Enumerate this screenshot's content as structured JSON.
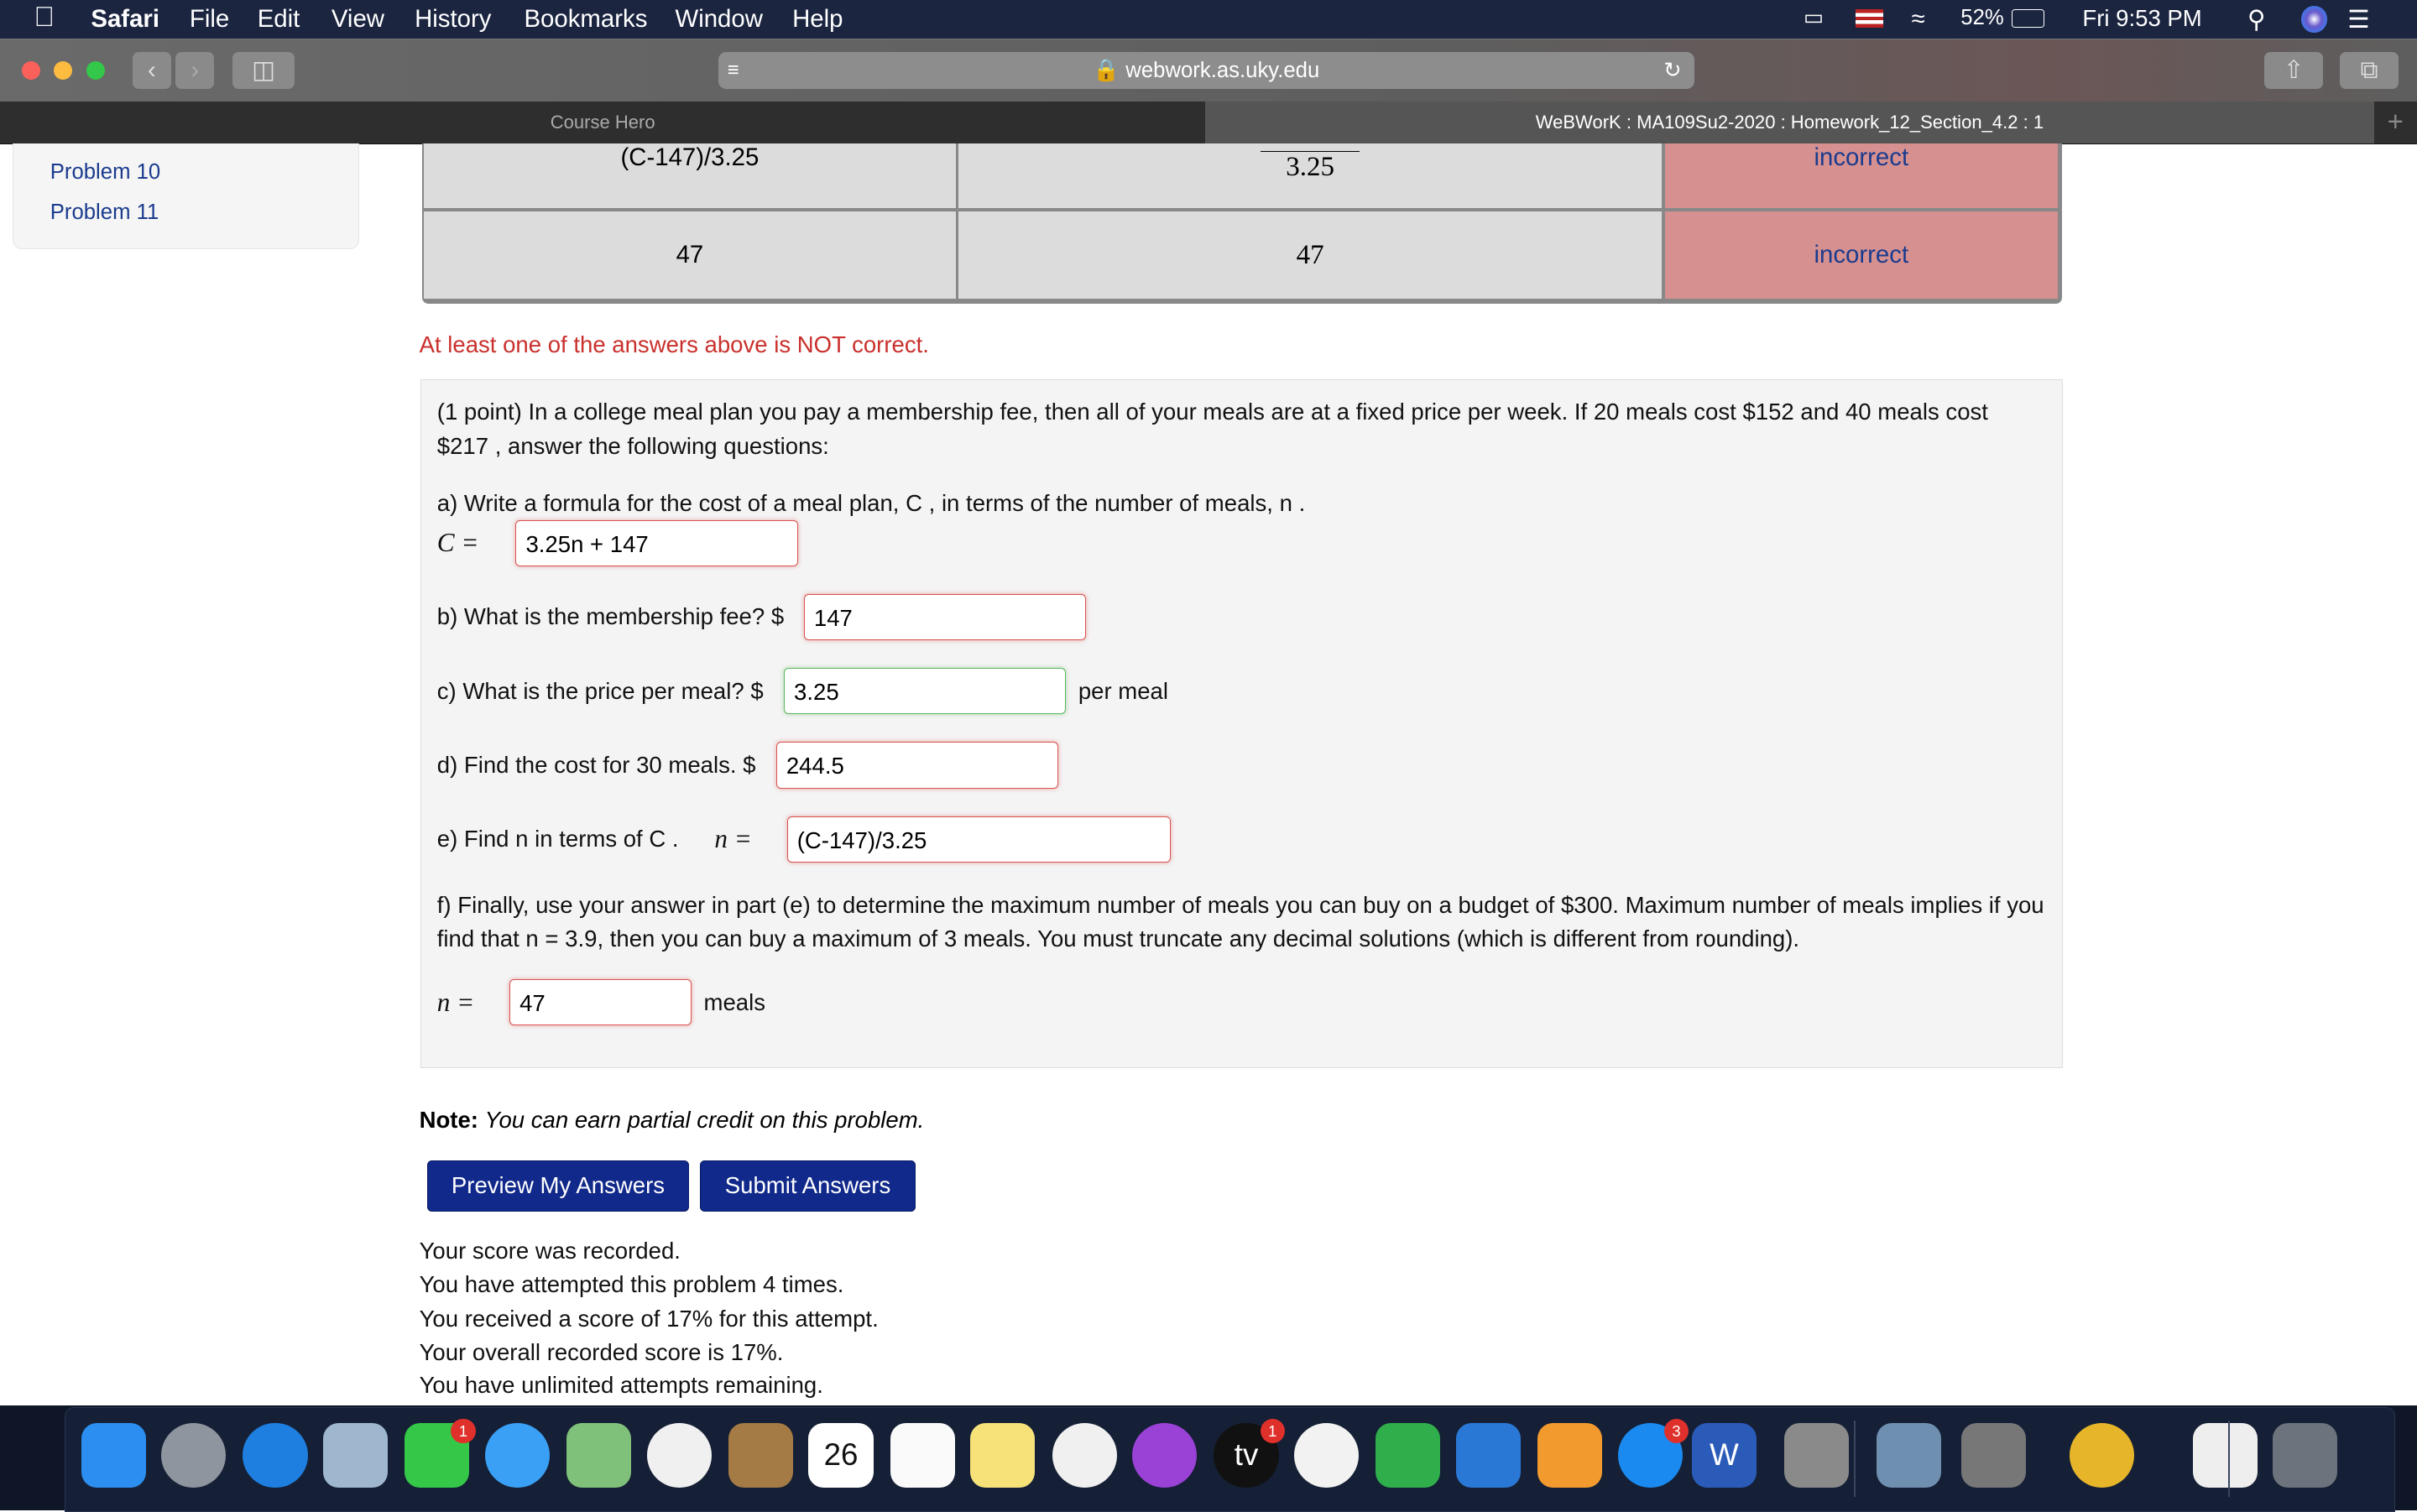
{
  "menubar": {
    "app": "Safari",
    "items": [
      "File",
      "Edit",
      "View",
      "History",
      "Bookmarks",
      "Window",
      "Help"
    ],
    "battery": "52%",
    "clock": "Fri 9:53 PM"
  },
  "toolbar": {
    "url": "webwork.as.uky.edu"
  },
  "tabs": [
    {
      "label": "Course Hero",
      "active": false
    },
    {
      "label": "WeBWorK : MA109Su2-2020 : Homework_12_Section_4.2 : 1",
      "active": true
    }
  ],
  "sidebar": {
    "items": [
      "Problem 10",
      "Problem 11"
    ]
  },
  "results": {
    "rows": [
      {
        "entered": "(C-147)/3.25",
        "preview": "3.25",
        "result": "incorrect"
      },
      {
        "entered": "47",
        "preview": "47",
        "result": "incorrect"
      }
    ]
  },
  "message": "At least one of the answers above is NOT correct.",
  "problem": {
    "intro": "(1 point) In a college meal plan you pay a membership fee, then all of your meals are at a fixed price per week. If 20 meals cost $152 and 40 meals cost $217 , answer the following questions:",
    "a": "a) Write a formula for the cost of a meal plan, C , in terms of the number of meals, n .",
    "a_label": "C =",
    "a_value": "3.25n + 147",
    "b": "b) What is the membership fee? $",
    "b_value": "147",
    "c": "c) What is the price per meal? $",
    "c_value": "3.25",
    "c_suffix": "per meal",
    "d": "d) Find the cost for 30 meals. $",
    "d_value": "244.5",
    "e": "e) Find n in terms of C .",
    "e_label": "n =",
    "e_value": "(C-147)/3.25",
    "f": "f) Finally, use your answer in part (e) to determine the maximum number of meals you can buy on a budget of $300. Maximum number of meals implies if you find that n = 3.9, then you can buy a maximum of 3 meals. You must truncate any decimal solutions (which is different from rounding).",
    "f_label": "n =",
    "f_value": "47",
    "f_suffix": "meals"
  },
  "note": {
    "bold": "Note:",
    "text": "You can earn partial credit on this problem."
  },
  "buttons": {
    "preview": "Preview My Answers",
    "submit": "Submit Answers"
  },
  "score_lines": [
    "Your score was recorded.",
    "You have attempted this problem 4 times.",
    "You received a score of 17% for this attempt.",
    "Your overall recorded score is 17%.",
    "You have unlimited attempts remaining."
  ],
  "dock": [
    {
      "name": "finder",
      "color": "#2b8ef0"
    },
    {
      "name": "launchpad",
      "color": "#8e959e"
    },
    {
      "name": "safari",
      "color": "#1e7fe0"
    },
    {
      "name": "mail-stamp",
      "color": "#9fb6cf"
    },
    {
      "name": "facetime",
      "color": "#34c748",
      "badge": "1"
    },
    {
      "name": "messages",
      "color": "#3aa0f5"
    },
    {
      "name": "maps",
      "color": "#7fc07a"
    },
    {
      "name": "photos",
      "color": "#f0f0f0"
    },
    {
      "name": "contacts",
      "color": "#a47a45"
    },
    {
      "name": "calendar",
      "color": "#ffffff",
      "text": "26"
    },
    {
      "name": "reminders",
      "color": "#fafafa"
    },
    {
      "name": "notes",
      "color": "#f7e27a"
    },
    {
      "name": "music",
      "color": "#f0f0f0"
    },
    {
      "name": "podcasts",
      "color": "#9a41d6"
    },
    {
      "name": "apple-tv",
      "color": "#111111",
      "badge": "1",
      "text": "tv"
    },
    {
      "name": "news",
      "color": "#f2f2f2"
    },
    {
      "name": "numbers",
      "color": "#2fae4b"
    },
    {
      "name": "keynote",
      "color": "#2a78d6"
    },
    {
      "name": "pages",
      "color": "#f29a2e"
    },
    {
      "name": "app-store",
      "color": "#1b8af0",
      "badge": "3"
    },
    {
      "name": "word",
      "color": "#2b5bb8",
      "text": "W"
    },
    {
      "name": "system-preferences",
      "color": "#8a8a8a"
    },
    {
      "name": "preview",
      "color": "#6f8fb0"
    },
    {
      "name": "system-information",
      "color": "#777777"
    },
    {
      "name": "chrome",
      "color": "#e6b52a"
    },
    {
      "name": "docx-file",
      "color": "#eeeeee"
    },
    {
      "name": "trash",
      "color": "#6c737c"
    }
  ]
}
